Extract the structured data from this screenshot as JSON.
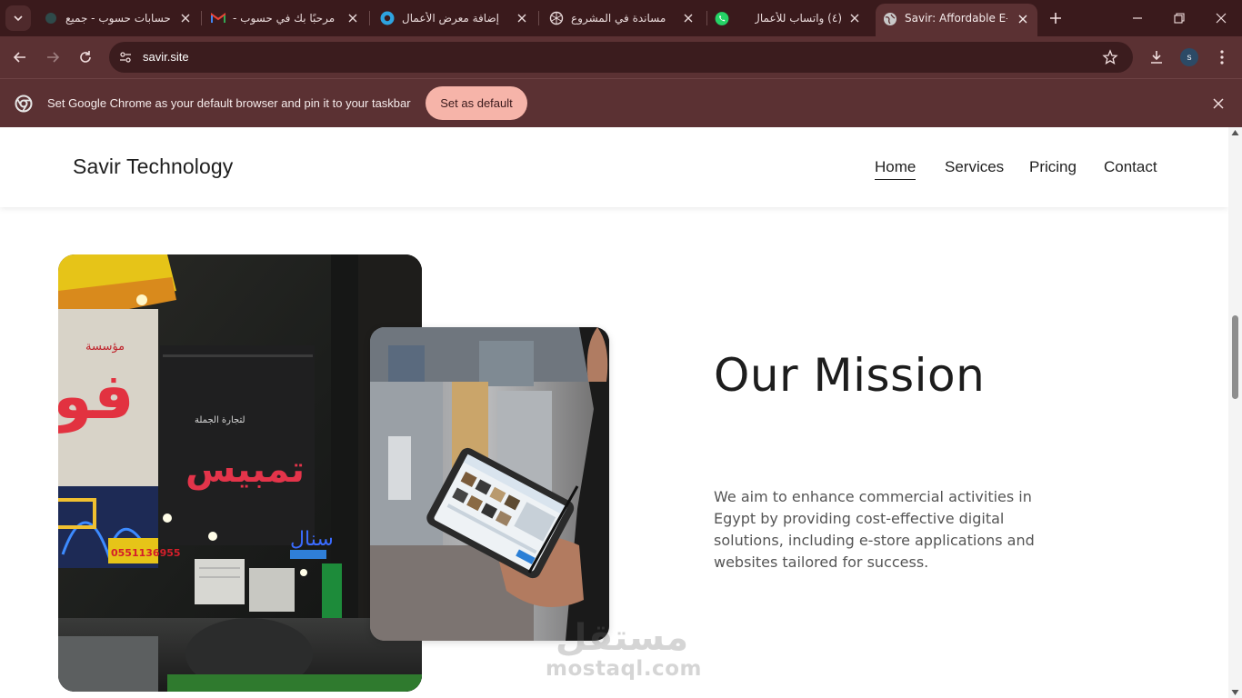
{
  "browser": {
    "tabs": [
      {
        "title": "حسابات حسوب - جميع",
        "favicon": "hsoub-icon"
      },
      {
        "title": "مرحبًا بك في حسوب -",
        "favicon": "gmail-icon"
      },
      {
        "title": "إضافة معرض الأعمال",
        "favicon": "mostaql-icon"
      },
      {
        "title": "مساندة في المشروع",
        "favicon": "openai-icon"
      },
      {
        "title": "(٤) واتساب للأعمال",
        "favicon": "whatsapp-icon"
      },
      {
        "title": "Savir: Affordable E-Store",
        "favicon": "globe-icon",
        "active": true
      }
    ],
    "url": "savir.site",
    "profile_initial": "s",
    "infobar": {
      "message": "Set Google Chrome as your default browser and pin it to your taskbar",
      "button_label": "Set as default"
    },
    "colors": {
      "frame": "#3a1a1c",
      "toolbar": "#5b3133",
      "omnibox": "#3b1c1e",
      "accent_button": "#f6b4a9"
    }
  },
  "site": {
    "brand": "Savir Technology",
    "nav": [
      "Home",
      "Services",
      "Pricing",
      "Contact"
    ],
    "active_nav": "Home",
    "mission": {
      "title": "Our Mission",
      "text": "We aim to enhance commercial activities in Egypt by providing cost-effective digital solutions, including e-store applications and websites tailored for success."
    },
    "left_photo_sign_number": "0551136955"
  },
  "watermark": {
    "arabic": "مستقل",
    "latin": "mostaql.com"
  }
}
